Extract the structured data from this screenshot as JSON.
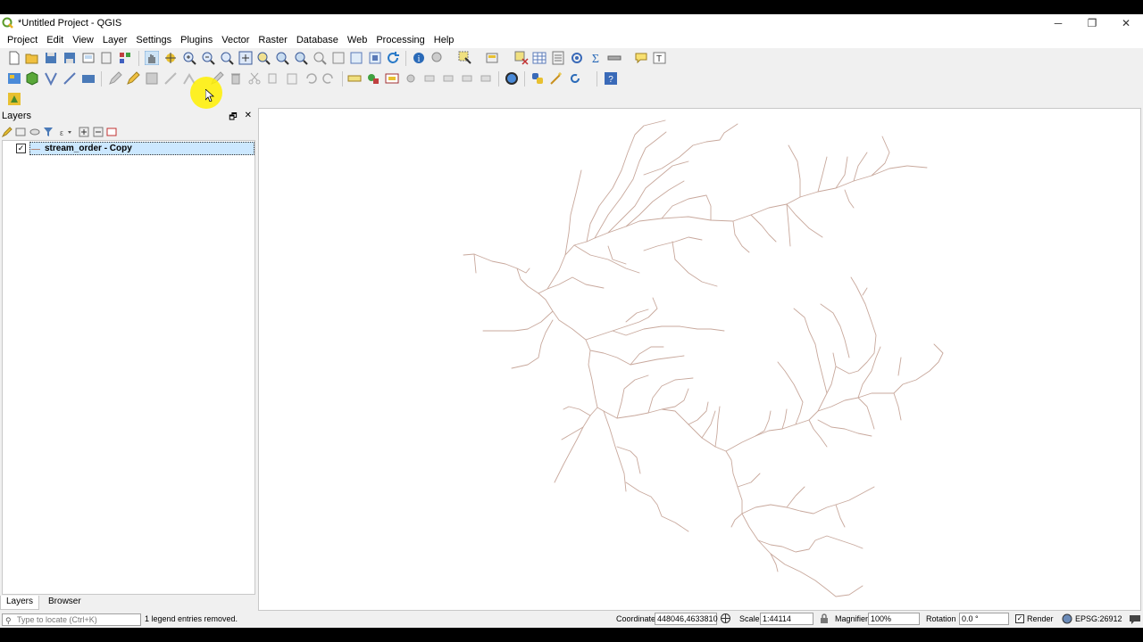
{
  "window": {
    "title": "*Untitled Project - QGIS",
    "minimize": "─",
    "maximize": "❐",
    "close": "✕"
  },
  "menu": [
    "Project",
    "Edit",
    "View",
    "Layer",
    "Settings",
    "Plugins",
    "Vector",
    "Raster",
    "Database",
    "Web",
    "Processing",
    "Help"
  ],
  "layers_panel": {
    "title": "Layers",
    "float_btn": "🗗",
    "close_btn": "✕",
    "layers": [
      {
        "name": "stream_order - Copy",
        "checked": true,
        "color": "#b48a7a"
      }
    ],
    "tabs": [
      "Layers",
      "Browser"
    ]
  },
  "status": {
    "locate_placeholder": "Type to locate (Ctrl+K)",
    "message": "1 legend entries removed.",
    "coordinate_label": "Coordinate",
    "coordinate_value": "448046,4633810",
    "scale_label": "Scale",
    "scale_value": "1:44114",
    "magnifier_label": "Magnifier",
    "magnifier_value": "100%",
    "rotation_label": "Rotation",
    "rotation_value": "0.0 °",
    "render_label": "Render",
    "crs": "EPSG:26912"
  },
  "colors": {
    "stream": "#c8a89c",
    "selection": "#cce8ff",
    "highlight": "#fff000"
  }
}
